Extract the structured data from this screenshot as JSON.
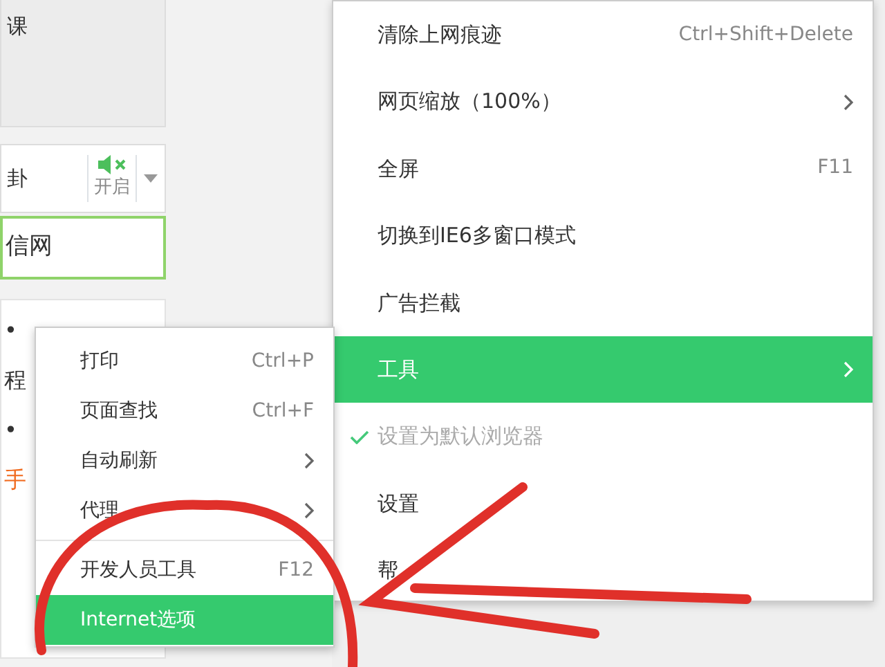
{
  "page": {
    "top_card_text": "课",
    "audio_bar": {
      "text": "卦",
      "sound_label": "开启"
    },
    "search_field_value": "信网",
    "news_lines": [
      {
        "text": "•",
        "color": "#333333"
      },
      {
        "text": "程",
        "color": "#333333"
      },
      {
        "text": "•",
        "color": "#333333"
      },
      {
        "text": "手",
        "color": "#f06a1e"
      }
    ]
  },
  "menu": {
    "items": [
      {
        "label": "清除上网痕迹",
        "kind": "shortcut",
        "shortcut": "Ctrl+Shift+Delete",
        "selected": false,
        "disabled": false,
        "checked": false
      },
      {
        "label": "网页缩放（100%）",
        "kind": "submenu",
        "selected": false,
        "disabled": false,
        "checked": false
      },
      {
        "label": "全屏",
        "kind": "shortcut",
        "shortcut": "F11",
        "selected": false,
        "disabled": false,
        "checked": false
      },
      {
        "label": "切换到IE6多窗口模式",
        "kind": "plain",
        "selected": false,
        "disabled": false,
        "checked": false
      },
      {
        "label": "广告拦截",
        "kind": "plain",
        "selected": false,
        "disabled": false,
        "checked": false
      },
      {
        "label": "工具",
        "kind": "submenu",
        "selected": true,
        "disabled": false,
        "checked": false
      },
      {
        "label": "设置为默认浏览器",
        "kind": "plain",
        "selected": false,
        "disabled": true,
        "checked": true
      },
      {
        "label": "设置",
        "kind": "plain",
        "selected": false,
        "disabled": false,
        "checked": false
      },
      {
        "label": "帮",
        "kind": "plain",
        "selected": false,
        "disabled": false,
        "checked": false
      }
    ]
  },
  "submenu": {
    "items": [
      {
        "label": "打印",
        "kind": "shortcut",
        "shortcut": "Ctrl+P",
        "selected": false
      },
      {
        "label": "页面查找",
        "kind": "shortcut",
        "shortcut": "Ctrl+F",
        "selected": false
      },
      {
        "label": "自动刷新",
        "kind": "submenu",
        "selected": false
      },
      {
        "label": "代理",
        "kind": "submenu",
        "selected": false
      },
      {
        "kind": "separator"
      },
      {
        "label": "开发人员工具",
        "kind": "shortcut",
        "shortcut": "F12",
        "selected": false
      },
      {
        "label": "Internet选项",
        "kind": "plain",
        "selected": true
      }
    ]
  }
}
